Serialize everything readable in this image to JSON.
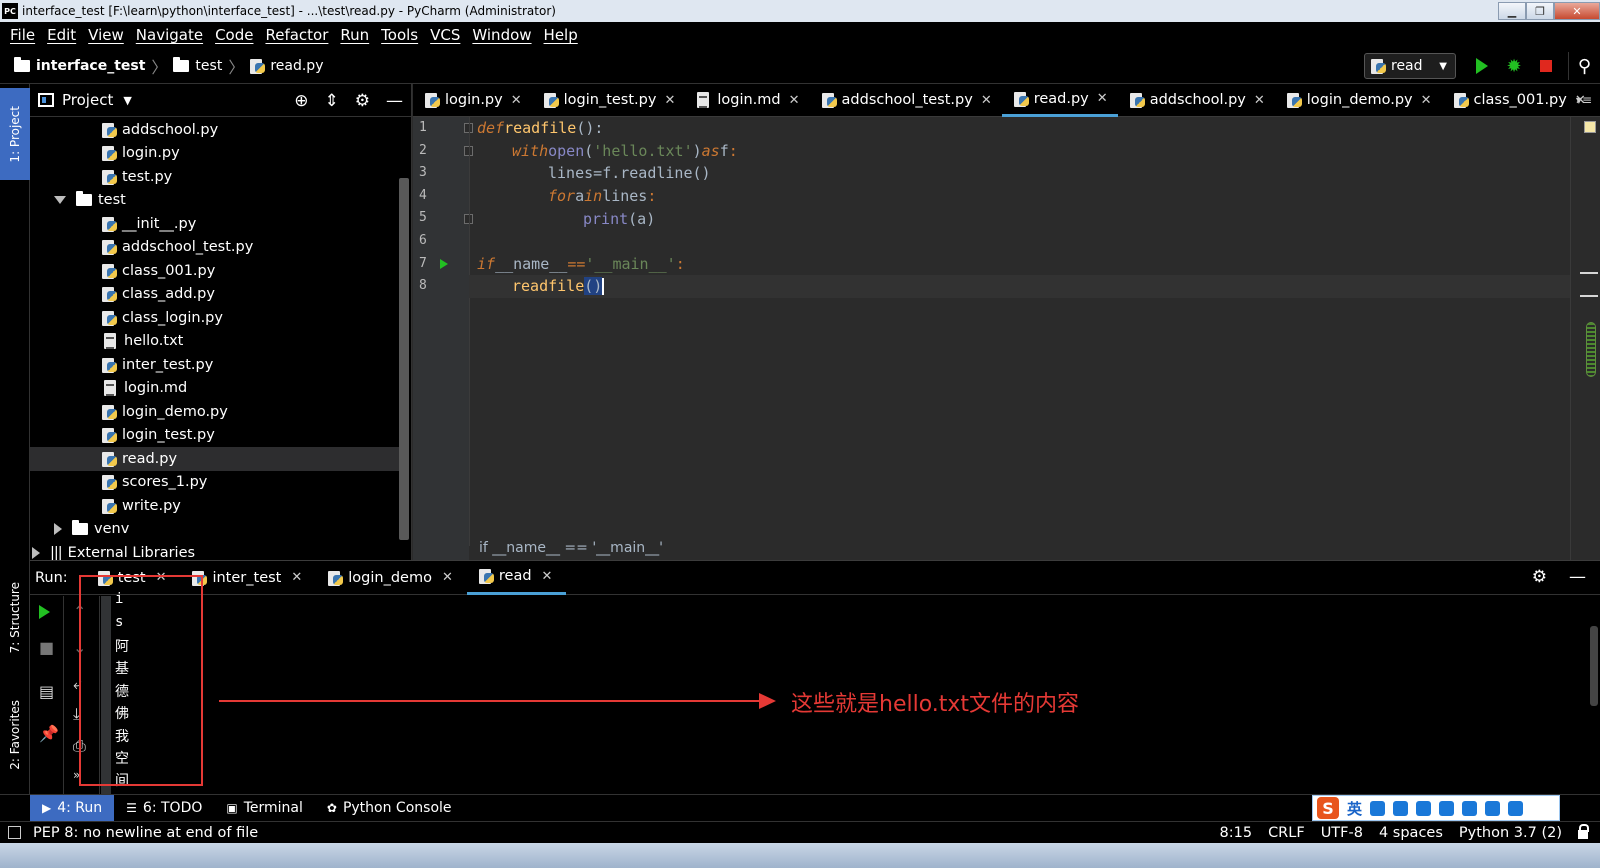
{
  "window": {
    "title": "interface_test [F:\\learn\\python\\interface_test] - ...\\test\\read.py - PyCharm (Administrator)",
    "app_badge": "PC"
  },
  "menu": [
    "File",
    "Edit",
    "View",
    "Navigate",
    "Code",
    "Refactor",
    "Run",
    "Tools",
    "VCS",
    "Window",
    "Help"
  ],
  "breadcrumb": {
    "project": "interface_test",
    "folder": "test",
    "file": "read.py"
  },
  "run_config": {
    "name": "read"
  },
  "left_strip": {
    "project_tab": "1: Project",
    "structure_tab": "7: Structure",
    "favorites_tab": "2: Favorites"
  },
  "project_panel": {
    "title": "Project",
    "tree": [
      {
        "label": "addschool.py",
        "icon": "python-file-icon"
      },
      {
        "label": "login.py",
        "icon": "python-file-icon"
      },
      {
        "label": "test.py",
        "icon": "python-file-icon"
      },
      {
        "label": "test",
        "icon": "folder-icon",
        "expanded": true
      },
      {
        "label": "__init__.py",
        "icon": "python-file-icon"
      },
      {
        "label": "addschool_test.py",
        "icon": "python-file-icon"
      },
      {
        "label": "class_001.py",
        "icon": "python-file-icon"
      },
      {
        "label": "class_add.py",
        "icon": "python-file-icon"
      },
      {
        "label": "class_login.py",
        "icon": "python-file-icon"
      },
      {
        "label": "hello.txt",
        "icon": "text-file-icon"
      },
      {
        "label": "inter_test.py",
        "icon": "python-file-icon"
      },
      {
        "label": "login.md",
        "icon": "text-file-icon"
      },
      {
        "label": "login_demo.py",
        "icon": "python-file-icon"
      },
      {
        "label": "login_test.py",
        "icon": "python-file-icon"
      },
      {
        "label": "read.py",
        "icon": "python-file-icon",
        "selected": true
      },
      {
        "label": "scores_1.py",
        "icon": "python-file-icon"
      },
      {
        "label": "write.py",
        "icon": "python-file-icon"
      },
      {
        "label": "venv",
        "icon": "folder-icon",
        "expanded": false
      },
      {
        "label": "External Libraries",
        "icon": "library-icon",
        "expanded": false
      }
    ]
  },
  "editor_tabs": [
    {
      "label": "login.py",
      "icon": "python-file-icon"
    },
    {
      "label": "login_test.py",
      "icon": "python-file-icon"
    },
    {
      "label": "login.md",
      "icon": "text-file-icon"
    },
    {
      "label": "addschool_test.py",
      "icon": "python-file-icon"
    },
    {
      "label": "read.py",
      "icon": "python-file-icon",
      "active": true
    },
    {
      "label": "addschool.py",
      "icon": "python-file-icon"
    },
    {
      "label": "login_demo.py",
      "icon": "python-file-icon"
    },
    {
      "label": "class_001.py",
      "icon": "python-file-icon"
    }
  ],
  "editor": {
    "line_numbers": [
      "1",
      "2",
      "3",
      "4",
      "5",
      "6",
      "7",
      "8"
    ],
    "code": {
      "l1_def": "def",
      "l1_name": "readfile",
      "l1_rest": "():",
      "l2_with": "with",
      "l2_open": "open",
      "l2_p1": "(",
      "l2_str": "'hello.txt'",
      "l2_p2": ")",
      "l2_as": "as",
      "l2_f": "f",
      "l2_colon": ":",
      "l3_lines": "lines",
      "l3_eq": "=",
      "l3_call": "f.readline()",
      "l4_for": "for",
      "l4_a": "a",
      "l4_in": "in",
      "l4_lines": "lines",
      "l4_colon": ":",
      "l5_print": "print",
      "l5_arg": "(a)",
      "l7_if": "if",
      "l7_name": "__name__",
      "l7_eq": "==",
      "l7_str": "'__main__'",
      "l7_colon": ":",
      "l8_call": "readfile",
      "l8_parens": "()"
    },
    "context_breadcrumb": "if __name__ == '__main__'"
  },
  "run_panel": {
    "label": "Run:",
    "tabs": [
      {
        "label": "test",
        "icon": "python-run-icon"
      },
      {
        "label": "inter_test",
        "icon": "python-run-icon"
      },
      {
        "label": "login_demo",
        "icon": "python-run-icon"
      },
      {
        "label": "read",
        "icon": "python-run-icon",
        "active": true
      }
    ],
    "output": [
      "i",
      "s",
      "阿",
      "基",
      "德",
      "佛",
      "我",
      "空",
      "间"
    ],
    "annotation": "这些就是hello.txt文件的内容"
  },
  "bottom_tabs": [
    {
      "label": "4: Run",
      "icon": "run-icon",
      "active": true
    },
    {
      "label": "6: TODO",
      "icon": "todo-icon"
    },
    {
      "label": "Terminal",
      "icon": "terminal-icon"
    },
    {
      "label": "Python Console",
      "icon": "python-console-icon"
    }
  ],
  "ime": {
    "lang": "英",
    "badge": "S"
  },
  "status": {
    "message": "PEP 8: no newline at end of file",
    "position": "8:15",
    "line_sep": "CRLF",
    "encoding": "UTF-8",
    "indent": "4 spaces",
    "interpreter": "Python 3.7 (2)"
  },
  "colors": {
    "accent": "#4aa0d6",
    "active_tool": "#3d6bc1",
    "annotation": "#e53935",
    "run_green": "#22c022",
    "stop_red": "#e0281e"
  }
}
